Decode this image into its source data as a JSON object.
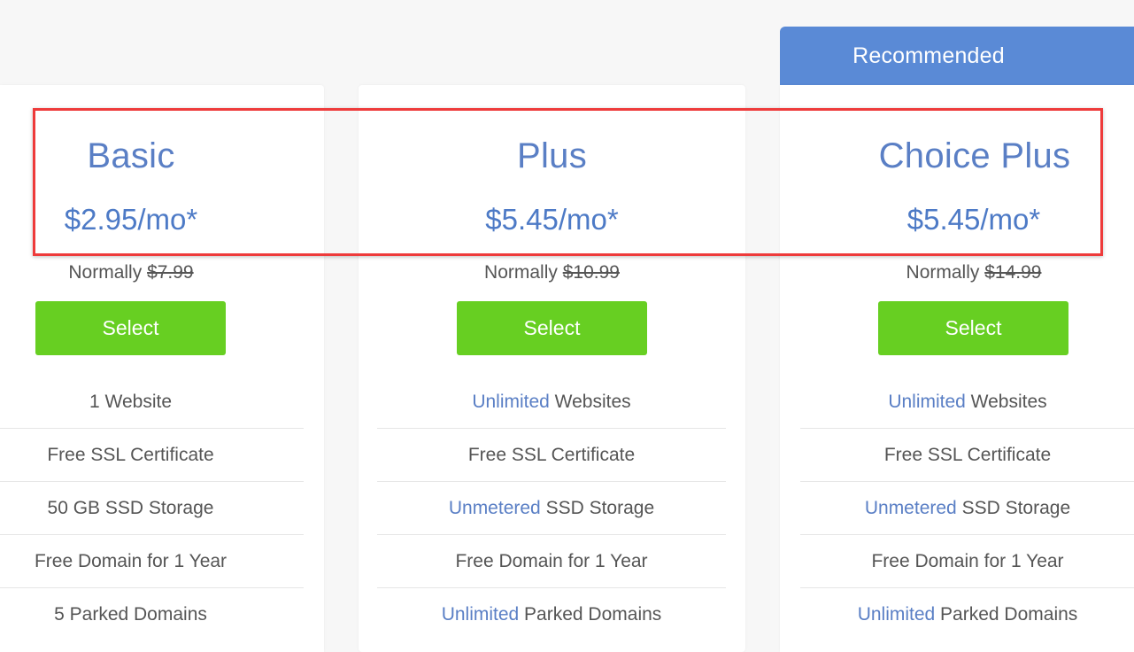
{
  "recommended_label": "Recommended",
  "plans": [
    {
      "name": "Basic",
      "price": "$2.95/mo*",
      "normally_label": "Normally",
      "normally_price": "$7.99",
      "select_label": "Select",
      "features": [
        {
          "highlight": "",
          "text": "1 Website"
        },
        {
          "highlight": "",
          "text": "Free SSL Certificate"
        },
        {
          "highlight": "",
          "text": "50 GB SSD Storage"
        },
        {
          "highlight": "",
          "text": "Free Domain for 1 Year"
        },
        {
          "highlight": "",
          "text": "5 Parked Domains"
        }
      ]
    },
    {
      "name": "Plus",
      "price": "$5.45/mo*",
      "normally_label": "Normally",
      "normally_price": "$10.99",
      "select_label": "Select",
      "features": [
        {
          "highlight": "Unlimited",
          "text": " Websites"
        },
        {
          "highlight": "",
          "text": "Free SSL Certificate"
        },
        {
          "highlight": "Unmetered",
          "text": " SSD Storage"
        },
        {
          "highlight": "",
          "text": "Free Domain for 1 Year"
        },
        {
          "highlight": "Unlimited",
          "text": " Parked Domains"
        }
      ]
    },
    {
      "name": "Choice Plus",
      "price": "$5.45/mo*",
      "normally_label": "Normally",
      "normally_price": "$14.99",
      "select_label": "Select",
      "features": [
        {
          "highlight": "Unlimited",
          "text": " Websites"
        },
        {
          "highlight": "",
          "text": "Free SSL Certificate"
        },
        {
          "highlight": "Unmetered",
          "text": " SSD Storage"
        },
        {
          "highlight": "",
          "text": "Free Domain for 1 Year"
        },
        {
          "highlight": "Unlimited",
          "text": " Parked Domains"
        }
      ]
    }
  ],
  "colors": {
    "accent_blue": "#5a7fc5",
    "recommended_bg": "#5a8ad6",
    "select_green": "#67cf22",
    "highlight_box": "#ee3b3b"
  }
}
